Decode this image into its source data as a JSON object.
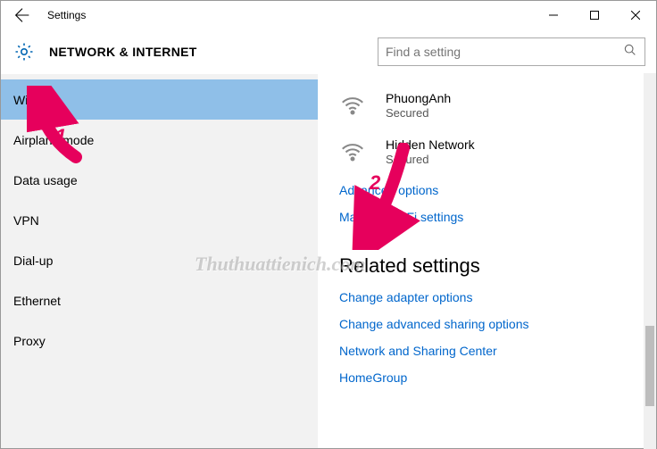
{
  "titlebar": {
    "title": "Settings"
  },
  "header": {
    "title": "NETWORK & INTERNET"
  },
  "search": {
    "placeholder": "Find a setting"
  },
  "sidebar": {
    "items": [
      {
        "label": "Wi-Fi",
        "active": true
      },
      {
        "label": "Airplane mode"
      },
      {
        "label": "Data usage"
      },
      {
        "label": "VPN"
      },
      {
        "label": "Dial-up"
      },
      {
        "label": "Ethernet"
      },
      {
        "label": "Proxy"
      }
    ]
  },
  "content": {
    "networks": [
      {
        "name": "PhuongAnh",
        "status": "Secured"
      },
      {
        "name": "Hidden Network",
        "status": "Secured"
      }
    ],
    "links": {
      "advanced": "Advanced options",
      "manage": "Manage Wi-Fi settings"
    },
    "related_title": "Related settings",
    "related": {
      "adapter": "Change adapter options",
      "sharing": "Change advanced sharing options",
      "center": "Network and Sharing Center",
      "homegroup": "HomeGroup"
    }
  },
  "annotations": {
    "a1": "1",
    "a2": "2"
  },
  "watermark": "Thuthuattienich.com"
}
